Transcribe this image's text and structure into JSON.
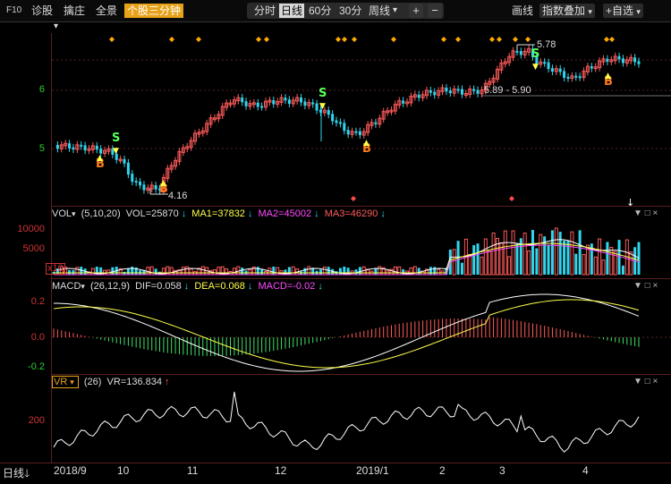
{
  "toolbar": {
    "f10": "F10",
    "diagnose": "诊股",
    "pick": "擒庄",
    "panorama": "全景",
    "stock_3min": "个股三分钟",
    "periods": [
      "分时",
      "日线",
      "60分",
      "30分",
      "周线"
    ],
    "selected_period": "日线",
    "period_more": "▾",
    "plus": "+",
    "minus": "−",
    "draw": "画线",
    "index_overlay": "指数叠加",
    "add_fav": "+自选"
  },
  "subbar": {
    "marker": "▾"
  },
  "kline": {
    "y_labels": [
      "6",
      "5"
    ],
    "annotations": {
      "high": "5.78",
      "low": "4.16",
      "range": "5.89 - 5.90"
    },
    "signals": [
      {
        "type": "S",
        "date": "2018-09-20"
      },
      {
        "type": "B",
        "date": "2018-09-19"
      },
      {
        "type": "B",
        "date": "2018-10-19"
      },
      {
        "type": "S",
        "date": "2018-12-13"
      },
      {
        "type": "B",
        "date": "2018-12-21"
      },
      {
        "type": "S",
        "date": "2019-03-13"
      },
      {
        "type": "B",
        "date": "2019-04-18"
      }
    ]
  },
  "vol": {
    "name": "VOL",
    "params": "(5,10,20)",
    "value": "VOL=25870",
    "ma1": "MA1=37832",
    "ma2": "MA2=45002",
    "ma3": "MA3=46290",
    "y_labels": [
      "10000",
      "5000"
    ],
    "unit": "x10"
  },
  "macd": {
    "name": "MACD",
    "params": "(26,12,9)",
    "dif": "DIF=0.058",
    "dea": "DEA=0.068",
    "macd": "MACD=-0.02",
    "y_labels": [
      "0.2",
      "0.0",
      "-0.2"
    ]
  },
  "vr": {
    "name": "VR",
    "params": "(26)",
    "value": "VR=136.834",
    "y_labels": [
      "200"
    ]
  },
  "window_controls": [
    "▼",
    "□",
    "×"
  ],
  "xaxis": {
    "period_label": "日线",
    "labels": [
      "2018/9",
      "10",
      "11",
      "12",
      "2019/1",
      "2",
      "3",
      "4"
    ]
  },
  "colors": {
    "up": "#ff5b5b",
    "down": "#2fd6ee",
    "ma1": "#ffffff",
    "ma2": "#ffff4a",
    "ma3": "#ff4aff",
    "signal_s": "#5aff5a",
    "signal_b": "#ff7a1a",
    "diamond": "#ffaa00"
  }
}
